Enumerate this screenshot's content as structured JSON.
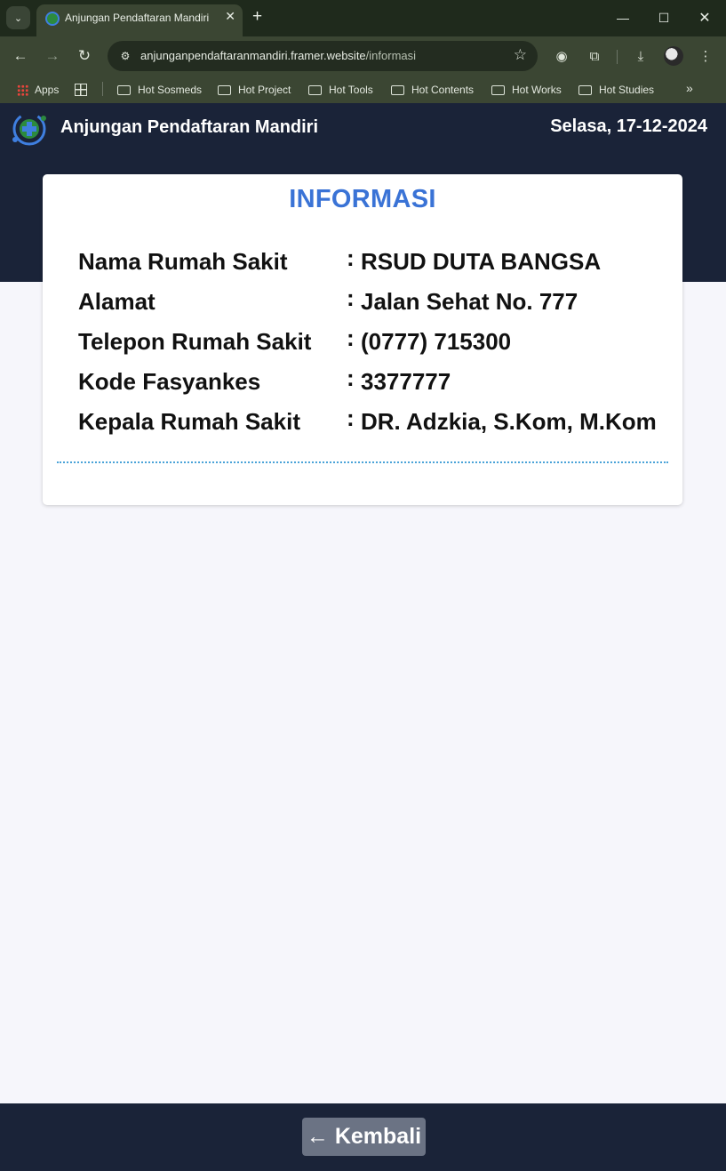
{
  "browser": {
    "tab_title": "Anjungan Pendaftaran Mandiri",
    "url_host": "anjunganpendaftaranmandiri.framer.website",
    "url_path": "/informasi",
    "bookmarks": [
      {
        "label": "Apps"
      },
      {
        "label": "Hot Sosmeds"
      },
      {
        "label": "Hot Project"
      },
      {
        "label": "Hot Tools"
      },
      {
        "label": "Hot Contents"
      },
      {
        "label": "Hot Works"
      },
      {
        "label": "Hot Studies"
      }
    ]
  },
  "header": {
    "title": "Anjungan Pendaftaran Mandiri",
    "date": "Selasa, 17-12-2024"
  },
  "card": {
    "title": "INFORMASI",
    "rows": [
      {
        "label": "Nama Rumah Sakit",
        "sep": ":",
        "value": "RSUD DUTA BANGSA"
      },
      {
        "label": "Alamat",
        "sep": ":",
        "value": "Jalan Sehat No. 777"
      },
      {
        "label": "Telepon Rumah Sakit",
        "sep": ":",
        "value": "(0777) 715300"
      },
      {
        "label": "Kode Fasyankes",
        "sep": ":",
        "value": "3377777"
      },
      {
        "label": "Kepala Rumah Sakit",
        "sep": ":",
        "value": "DR. Adzkia, S.Kom, M.Kom"
      }
    ]
  },
  "footer": {
    "back_label": "← Kembali"
  },
  "colors": {
    "header_bg": "#1a2338",
    "accent_title": "#3a73d6",
    "divider": "#4aa3d8",
    "button_bg": "#6b7384"
  }
}
